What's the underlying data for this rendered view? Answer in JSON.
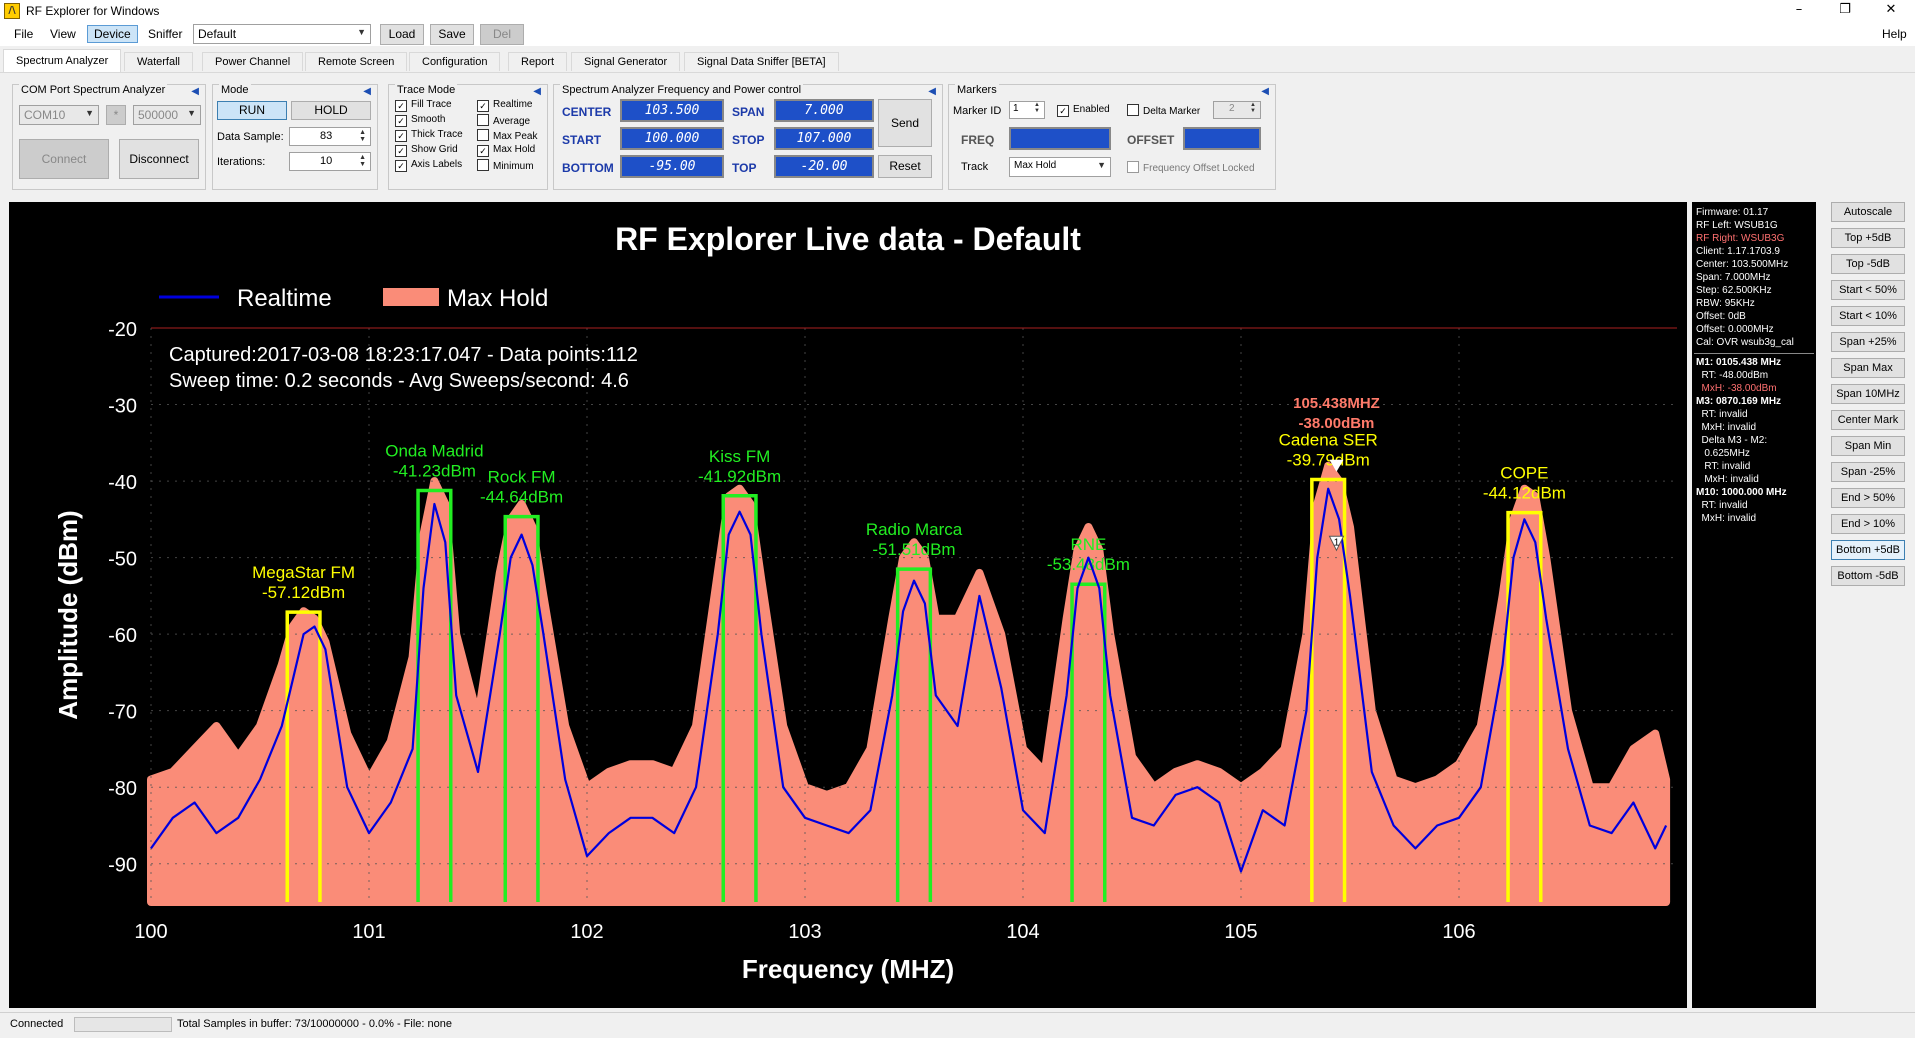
{
  "window": {
    "title": "RF Explorer for Windows",
    "minimize": "–",
    "maximize": "❐",
    "close": "✕"
  },
  "menu": {
    "file": "File",
    "view": "View",
    "device": "Device",
    "sniffer": "Sniffer",
    "help": "Help",
    "preset_value": "Default",
    "load": "Load",
    "save": "Save",
    "del": "Del"
  },
  "tabs": [
    "Spectrum Analyzer",
    "Waterfall",
    "Power Channel",
    "Remote Screen",
    "Configuration",
    "Report",
    "Signal Generator",
    "Signal Data Sniffer [BETA]"
  ],
  "com": {
    "title": "COM Port Spectrum Analyzer",
    "port": "COM10",
    "star": "*",
    "baud": "500000",
    "connect": "Connect",
    "disconnect": "Disconnect"
  },
  "mode": {
    "title": "Mode",
    "run": "RUN",
    "hold": "HOLD",
    "data_sample_label": "Data Sample:",
    "data_sample": "83",
    "iterations_label": "Iterations:",
    "iterations": "10"
  },
  "trace": {
    "title": "Trace Mode",
    "options": [
      {
        "label": "Fill Trace",
        "checked": true
      },
      {
        "label": "Realtime",
        "checked": true
      },
      {
        "label": "Smooth",
        "checked": true
      },
      {
        "label": "Average",
        "checked": false
      },
      {
        "label": "Thick Trace",
        "checked": true
      },
      {
        "label": "Max Peak",
        "checked": false
      },
      {
        "label": "Show Grid",
        "checked": true
      },
      {
        "label": "Max Hold",
        "checked": true
      },
      {
        "label": "Axis Labels",
        "checked": true
      },
      {
        "label": "Minimum",
        "checked": false
      }
    ]
  },
  "freqctl": {
    "title": "Spectrum Analyzer Frequency and Power control",
    "center_label": "CENTER",
    "center": "103.500",
    "span_label": "SPAN",
    "span": "7.000",
    "start_label": "START",
    "start": "100.000",
    "stop_label": "STOP",
    "stop": "107.000",
    "bottom_label": "BOTTOM",
    "bottom": "-95.00",
    "top_label": "TOP",
    "top": "-20.00",
    "send": "Send",
    "reset": "Reset"
  },
  "markers": {
    "title": "Markers",
    "id_label": "Marker ID",
    "id": "1",
    "enabled_label": "Enabled",
    "delta_label": "Delta Marker",
    "delta_id": "2",
    "freq_label": "FREQ",
    "offset_label": "OFFSET",
    "track_label": "Track",
    "track_value": "Max Hold",
    "offset_locked": "Frequency Offset Locked"
  },
  "info": {
    "lines": [
      {
        "text": "Firmware: 01.17",
        "color": "#ffffff",
        "bold": false
      },
      {
        "text": "RF Left: WSUB1G",
        "color": "#ffffff",
        "bold": false
      },
      {
        "text": "RF Right: WSUB3G",
        "color": "#ff7070",
        "bold": false
      },
      {
        "text": "Client: 1.17.1703.9",
        "color": "#ffffff",
        "bold": false
      },
      {
        "text": "Center: 103.500MHz",
        "color": "#ffffff",
        "bold": false
      },
      {
        "text": "Span: 7.000MHz",
        "color": "#ffffff",
        "bold": false
      },
      {
        "text": "Step: 62.500KHz",
        "color": "#ffffff",
        "bold": false
      },
      {
        "text": "RBW: 95KHz",
        "color": "#ffffff",
        "bold": false
      },
      {
        "text": "Offset: 0dB",
        "color": "#ffffff",
        "bold": false
      },
      {
        "text": "Offset: 0.000MHz",
        "color": "#ffffff",
        "bold": false
      },
      {
        "text": "Cal: OVR wsub3g_cal",
        "color": "#ffffff",
        "bold": false
      }
    ],
    "marker_lines": [
      {
        "text": "M1: 0105.438 MHz",
        "color": "#ffffff",
        "bold": true
      },
      {
        "text": "  RT: -48.00dBm",
        "color": "#ffffff",
        "bold": false
      },
      {
        "text": "  MxH: -38.00dBm",
        "color": "#ff7070",
        "bold": false
      },
      {
        "text": "M3: 0870.169 MHz",
        "color": "#ffffff",
        "bold": true
      },
      {
        "text": "  RT: invalid",
        "color": "#ffffff",
        "bold": false
      },
      {
        "text": "  MxH: invalid",
        "color": "#ffffff",
        "bold": false
      },
      {
        "text": "  Delta M3 - M2:",
        "color": "#ffffff",
        "bold": false
      },
      {
        "text": "   0.625MHz",
        "color": "#ffffff",
        "bold": false
      },
      {
        "text": "   RT: invalid",
        "color": "#ffffff",
        "bold": false
      },
      {
        "text": "   MxH: invalid",
        "color": "#ffffff",
        "bold": false
      },
      {
        "text": "M10: 1000.000 MHz",
        "color": "#ffffff",
        "bold": true
      },
      {
        "text": "  RT: invalid",
        "color": "#ffffff",
        "bold": false
      },
      {
        "text": "  MxH: invalid",
        "color": "#ffffff",
        "bold": false
      }
    ]
  },
  "side_buttons": [
    "Autoscale",
    "Top +5dB",
    "Top -5dB",
    "Start < 50%",
    "Start < 10%",
    "Span +25%",
    "Span Max",
    "Span 10MHz",
    "Center Mark",
    "Span Min",
    "Span -25%",
    "End > 50%",
    "End > 10%",
    "Bottom +5dB",
    "Bottom -5dB"
  ],
  "status": {
    "left": "Connected",
    "text": "Total Samples in buffer: 73/10000000 - 0.0%  - File: none"
  },
  "chart_data": {
    "type": "line",
    "title": "RF Explorer Live data - Default",
    "xlabel": "Frequency (MHZ)",
    "ylabel": "Amplitude (dBm)",
    "xlim": [
      100,
      107
    ],
    "ylim": [
      -95,
      -20
    ],
    "xticks": [
      100,
      101,
      102,
      103,
      104,
      105,
      106
    ],
    "yticks": [
      -20,
      -30,
      -40,
      -50,
      -60,
      -70,
      -80,
      -90
    ],
    "grid": true,
    "legend_position": "top-left",
    "info_lines": [
      "Captured:2017-03-08 18:23:17.047 - Data points:112",
      "Sweep time: 0.2 seconds - Avg Sweeps/second: 4.6"
    ],
    "colors": {
      "background": "#000000",
      "realtime": "#0000dd",
      "maxhold": "#fa8c78",
      "grid": "#555555",
      "text": "#ffffff",
      "annotation_yellow": "#ffff00",
      "annotation_green": "#22ee22"
    },
    "x": [
      100.0,
      100.1,
      100.2,
      100.3,
      100.4,
      100.5,
      100.6,
      100.65,
      100.7,
      100.75,
      100.8,
      100.9,
      101.0,
      101.1,
      101.2,
      101.25,
      101.3,
      101.35,
      101.4,
      101.5,
      101.6,
      101.65,
      101.7,
      101.75,
      101.8,
      101.9,
      102.0,
      102.1,
      102.2,
      102.3,
      102.4,
      102.5,
      102.6,
      102.65,
      102.7,
      102.75,
      102.8,
      102.9,
      103.0,
      103.1,
      103.2,
      103.3,
      103.4,
      103.45,
      103.5,
      103.55,
      103.6,
      103.7,
      103.8,
      103.9,
      104.0,
      104.1,
      104.2,
      104.25,
      104.3,
      104.35,
      104.4,
      104.5,
      104.6,
      104.7,
      104.8,
      104.9,
      105.0,
      105.1,
      105.2,
      105.3,
      105.35,
      105.4,
      105.45,
      105.5,
      105.6,
      105.7,
      105.8,
      105.9,
      106.0,
      106.1,
      106.2,
      106.25,
      106.3,
      106.35,
      106.4,
      106.5,
      106.6,
      106.7,
      106.8,
      106.9,
      106.95
    ],
    "series": [
      {
        "name": "Realtime",
        "values": [
          -88,
          -84,
          -82,
          -86,
          -84,
          -79,
          -72,
          -66,
          -60,
          -59,
          -62,
          -80,
          -86,
          -82,
          -75,
          -54,
          -43,
          -48,
          -68,
          -78,
          -60,
          -50,
          -47,
          -51,
          -60,
          -79,
          -89,
          -86,
          -84,
          -84,
          -86,
          -80,
          -60,
          -47,
          -44,
          -47,
          -60,
          -80,
          -84,
          -85,
          -86,
          -83,
          -68,
          -57,
          -53,
          -56,
          -68,
          -72,
          -55,
          -67,
          -83,
          -86,
          -68,
          -54,
          -50,
          -54,
          -68,
          -84,
          -85,
          -81,
          -80,
          -82,
          -91,
          -83,
          -85,
          -70,
          -50,
          -41,
          -45,
          -55,
          -78,
          -85,
          -88,
          -85,
          -84,
          -80,
          -64,
          -50,
          -45,
          -48,
          -58,
          -75,
          -85,
          -86,
          -82,
          -88,
          -85
        ]
      },
      {
        "name": "Max Hold",
        "values": [
          -79,
          -78,
          -75,
          -72,
          -76,
          -72,
          -64,
          -59,
          -57,
          -58,
          -61,
          -73,
          -79,
          -74,
          -63,
          -47,
          -40,
          -43,
          -60,
          -71,
          -52,
          -45,
          -43,
          -46,
          -55,
          -72,
          -80,
          -78,
          -77,
          -77,
          -78,
          -72,
          -52,
          -42,
          -41,
          -43,
          -53,
          -72,
          -80,
          -81,
          -80,
          -75,
          -58,
          -50,
          -48,
          -50,
          -58,
          -58,
          -52,
          -60,
          -75,
          -78,
          -58,
          -49,
          -46,
          -49,
          -60,
          -76,
          -80,
          -78,
          -77,
          -78,
          -80,
          -78,
          -75,
          -60,
          -43,
          -38,
          -40,
          -46,
          -70,
          -79,
          -80,
          -79,
          -77,
          -72,
          -55,
          -45,
          -41,
          -42,
          -50,
          -70,
          -80,
          -80,
          -75,
          -73,
          -79
        ]
      }
    ],
    "markers": [
      {
        "freq": 100.7,
        "level": -57.12,
        "width": 0.15,
        "name": "MegaStar FM",
        "value_text": "-57.12dBm",
        "color": "yellow"
      },
      {
        "freq": 101.3,
        "level": -41.23,
        "width": 0.15,
        "name": "Onda Madrid",
        "value_text": "-41.23dBm",
        "color": "green"
      },
      {
        "freq": 101.7,
        "level": -44.64,
        "width": 0.15,
        "name": "Rock FM",
        "value_text": "-44.64dBm",
        "color": "green"
      },
      {
        "freq": 102.7,
        "level": -41.92,
        "width": 0.15,
        "name": "Kiss FM",
        "value_text": "-41.92dBm",
        "color": "green"
      },
      {
        "freq": 103.5,
        "level": -51.51,
        "width": 0.15,
        "name": "Radio Marca",
        "value_text": "-51.51dBm",
        "color": "green"
      },
      {
        "freq": 104.3,
        "level": -53.48,
        "width": 0.15,
        "name": "RNE",
        "value_text": "-53.48dBm",
        "color": "green"
      },
      {
        "freq": 105.4,
        "level": -39.79,
        "width": 0.15,
        "name": "Cadena SER",
        "value_text": "-39.79dBm",
        "color": "yellow"
      },
      {
        "freq": 106.3,
        "level": -44.12,
        "width": 0.15,
        "name": "COPE",
        "value_text": "-44.12dBm",
        "color": "yellow"
      }
    ],
    "peak_marker": {
      "freq": 105.438,
      "level": -38.0,
      "freq_text": "105.438MHZ",
      "level_text": "-38.00dBm",
      "id": "1"
    }
  }
}
